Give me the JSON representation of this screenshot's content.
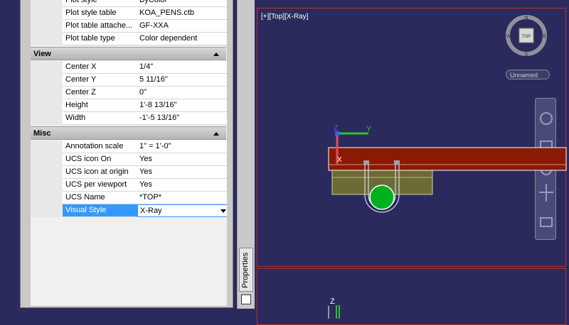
{
  "palette": {
    "tab_label": "Properties",
    "top_rows": [
      {
        "label": "Plot style",
        "value": "ByColor"
      },
      {
        "label": "Plot style table",
        "value": "KOA_PENS.ctb"
      },
      {
        "label": "Plot table attache...",
        "value": "GF-XXA"
      },
      {
        "label": "Plot table type",
        "value": "Color dependent"
      }
    ],
    "view_section": {
      "title": "View",
      "rows": [
        {
          "label": "Center X",
          "value": "1/4\""
        },
        {
          "label": "Center Y",
          "value": "5 11/16\""
        },
        {
          "label": "Center Z",
          "value": "0\""
        },
        {
          "label": "Height",
          "value": "1'-8 13/16\""
        },
        {
          "label": "Width",
          "value": "-1'-5 13/16\""
        }
      ]
    },
    "misc_section": {
      "title": "Misc",
      "rows": [
        {
          "label": "Annotation scale",
          "value": "1\" = 1'-0\""
        },
        {
          "label": "UCS icon On",
          "value": "Yes"
        },
        {
          "label": "UCS icon at origin",
          "value": "Yes"
        },
        {
          "label": "UCS per viewport",
          "value": "Yes"
        },
        {
          "label": "UCS Name",
          "value": "*TOP*"
        },
        {
          "label": "Visual Style",
          "value": "X-Ray"
        }
      ]
    }
  },
  "viewport": {
    "label": "[+][Top][X-Ray]",
    "named_view": "Unnamed",
    "viewcube": {
      "face": "TOP",
      "n": "N",
      "w": "W",
      "e": "E",
      "s": "S"
    },
    "ucs": {
      "x": "X",
      "y": "Y",
      "z": "Z"
    },
    "ucs2": {
      "z": "Z"
    }
  },
  "colors": {
    "canvas": "#2a2a5c",
    "beam": "#8b1a04",
    "plate": "#6b6b34",
    "pipe": "#00b020",
    "frame": "#b2342c"
  }
}
